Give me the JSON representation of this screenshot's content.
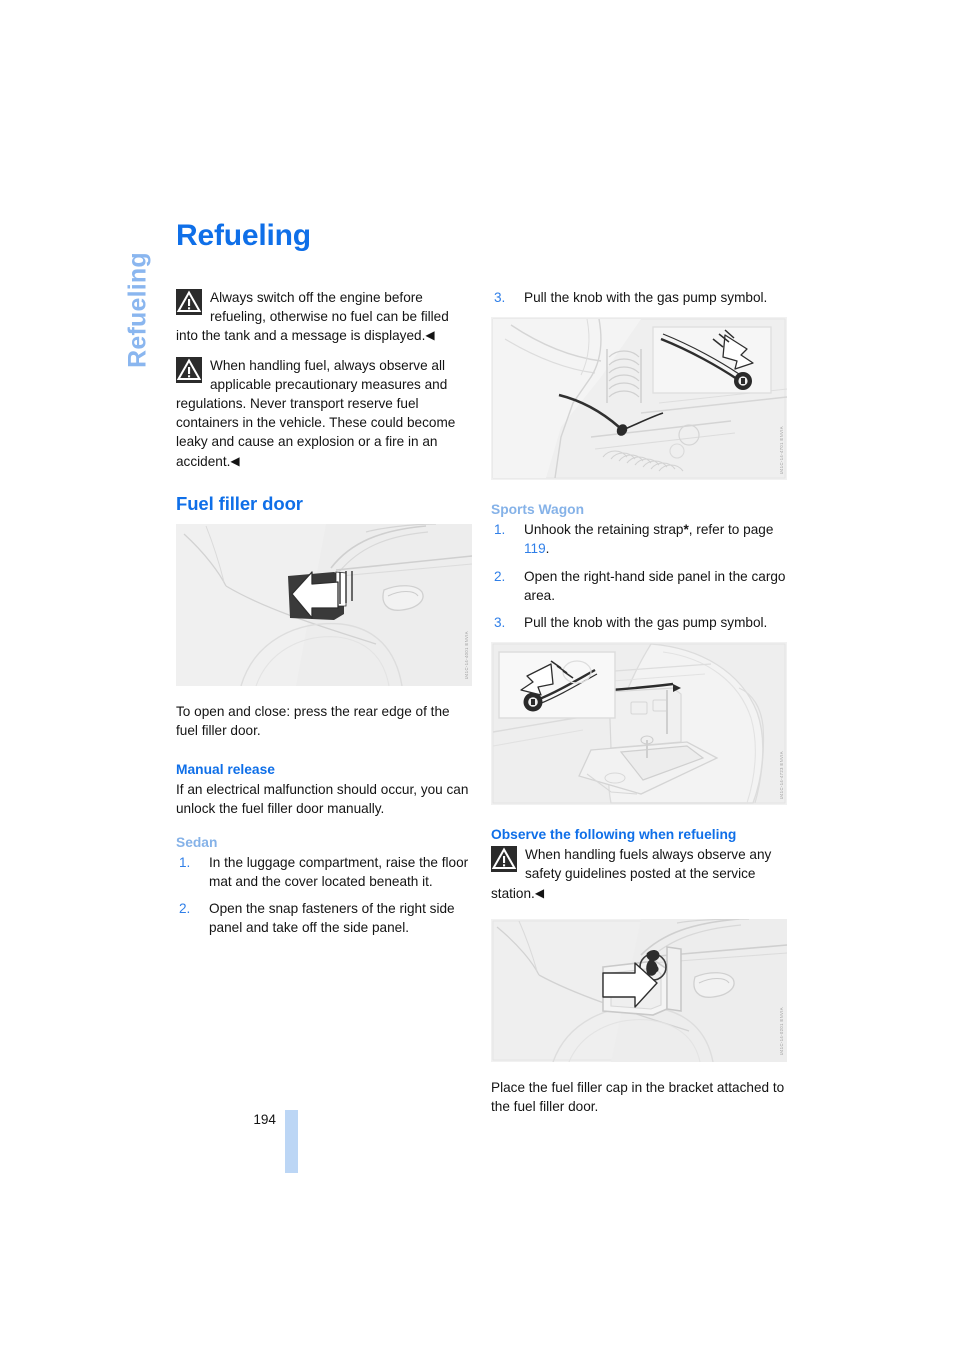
{
  "document": {
    "side_tab": "Refueling",
    "page_number": "194"
  },
  "title": "Refueling",
  "warnings": {
    "engine_off": {
      "icon": "warning-triangle-icon",
      "text": "Always switch off the engine before refueling, otherwise no fuel can be filled into the tank and a message is displayed.",
      "end_marker": "◀"
    },
    "handling_fuel": {
      "icon": "warning-triangle-icon",
      "text": "When handling fuel, always observe all applicable precautionary measures and regulations. Never transport reserve fuel containers in the vehicle. These could become leaky and cause an explosion or a fire in an accident.",
      "end_marker": "◀"
    },
    "service_station": {
      "icon": "warning-triangle-icon",
      "text": "When handling fuels always observe any safety guidelines posted at the service station.",
      "end_marker": "◀"
    }
  },
  "sections": {
    "fuel_filler_door": {
      "heading": "Fuel filler door",
      "figure": {
        "name": "fuel-filler-door-exterior-figure",
        "watermark": "U41C-14-4001 ENVIA"
      },
      "caption": "To open and close: press the rear edge of the fuel filler door."
    },
    "manual_release": {
      "heading": "Manual release",
      "intro": "If an electrical malfunction should occur, you can unlock the fuel filler door manually."
    },
    "sedan": {
      "heading": "Sedan",
      "steps": [
        {
          "num": "1.",
          "text": "In the luggage compartment, raise the floor mat and the cover located beneath it."
        },
        {
          "num": "2.",
          "text": "Open the snap fasteners of the right side panel and take off the side panel."
        }
      ]
    },
    "sedan_continued": {
      "steps": [
        {
          "num": "3.",
          "text": "Pull the knob with the gas pump symbol."
        }
      ],
      "figure": {
        "name": "sedan-trunk-knob-figure",
        "watermark": "U41C-14-4701 ENVIA"
      }
    },
    "sports_wagon": {
      "heading": "Sports Wagon",
      "steps": [
        {
          "num": "1.",
          "text_before": "Unhook the retaining strap",
          "asterisk": "*",
          "text_after": ", refer to page ",
          "page_ref": "119",
          "text_end": "."
        },
        {
          "num": "2.",
          "text": "Open the right-hand side panel in the cargo area."
        },
        {
          "num": "3.",
          "text": "Pull the knob with the gas pump symbol."
        }
      ],
      "figure": {
        "name": "sports-wagon-cargo-knob-figure",
        "watermark": "U41C-14-4723 ENVIA"
      }
    },
    "observe_refueling": {
      "heading": "Observe the following when refueling",
      "figure": {
        "name": "fuel-filler-cap-bracket-figure",
        "watermark": "U41C-14-0201 ENVIA"
      },
      "caption": "Place the fuel filler cap in the bracket attached to the fuel filler door."
    }
  },
  "colors": {
    "heading_blue": "#0f6fe8",
    "subheading_light_blue": "#85b2e8",
    "side_tab_blue": "#8ab6ef",
    "folio_bar_blue": "#bcd6f5",
    "figure_background": "#f2f2f2"
  }
}
